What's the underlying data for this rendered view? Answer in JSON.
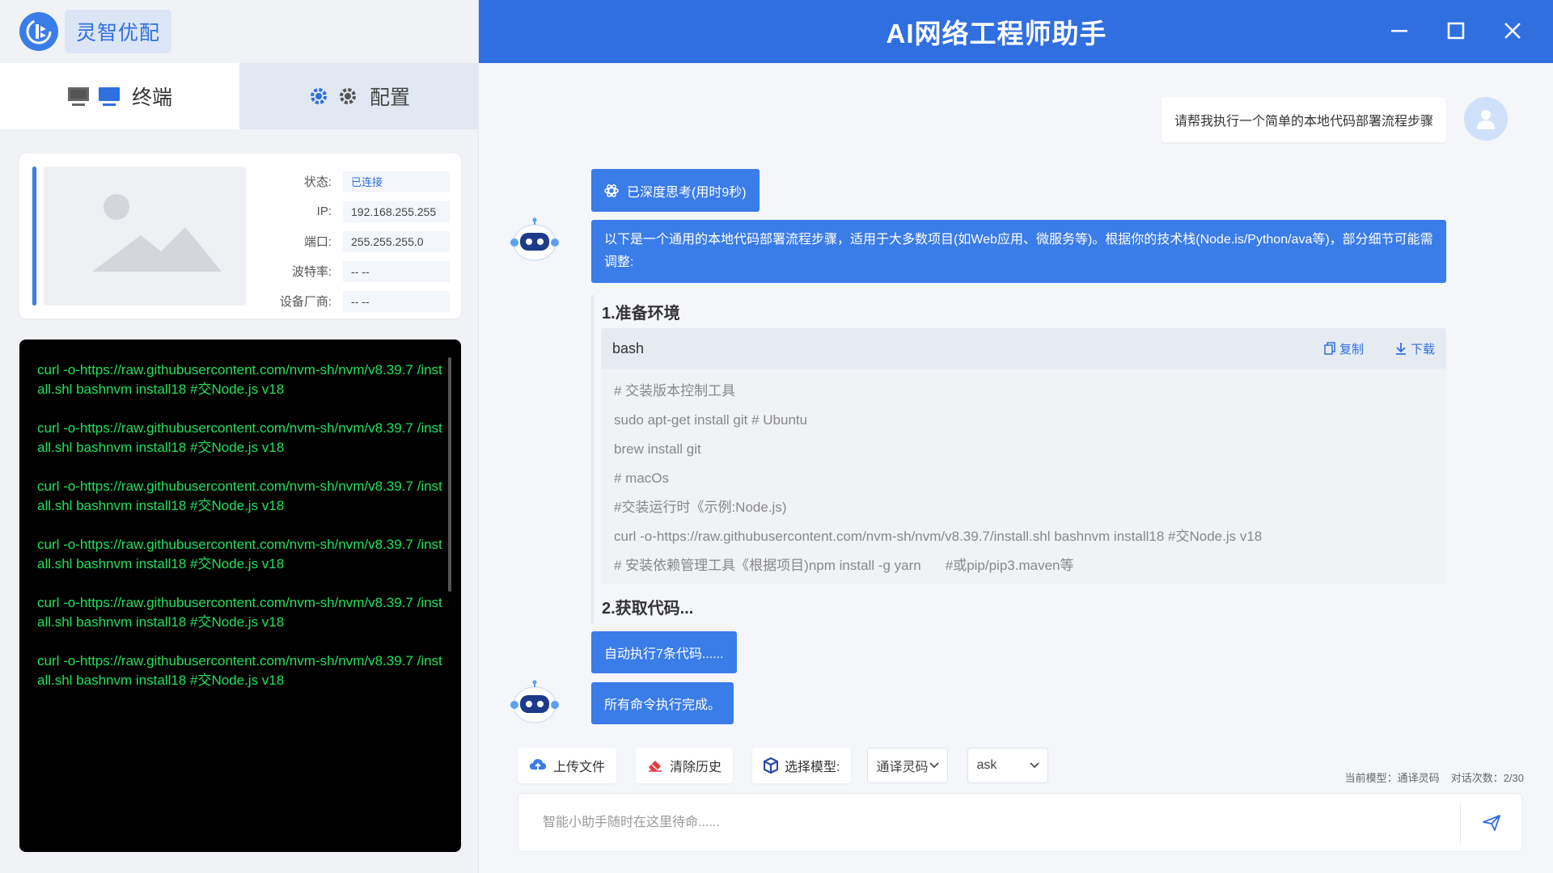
{
  "brand": {
    "name": "灵智优配"
  },
  "tabs": [
    {
      "label": "终端",
      "icon": "monitor-icon",
      "active": true
    },
    {
      "label": "配置",
      "icon": "gear-icon",
      "active": false
    }
  ],
  "device": {
    "fields": [
      {
        "label": "状态:",
        "value": "已连接"
      },
      {
        "label": "IP:",
        "value": "192.168.255.255"
      },
      {
        "label": "端口:",
        "value": "255.255.255.0"
      },
      {
        "label": "波特率:",
        "value": "-- --"
      },
      {
        "label": "设备厂商:",
        "value": "-- --"
      }
    ]
  },
  "terminal": {
    "lines": [
      "curl -o-https://raw.githubusercontent.com/nvm-sh/nvm/v8.39.7 /install.shl bashnvm install18 #交Node.js v18",
      "curl -o-https://raw.githubusercontent.com/nvm-sh/nvm/v8.39.7 /install.shl bashnvm install18 #交Node.js v18",
      "curl -o-https://raw.githubusercontent.com/nvm-sh/nvm/v8.39.7 /install.shl bashnvm install18 #交Node.js v18",
      "curl -o-https://raw.githubusercontent.com/nvm-sh/nvm/v8.39.7 /install.shl bashnvm install18 #交Node.js v18",
      "curl -o-https://raw.githubusercontent.com/nvm-sh/nvm/v8.39.7 /install.shl bashnvm install18 #交Node.js v18",
      "curl -o-https://raw.githubusercontent.com/nvm-sh/nvm/v8.39.7 /install.shl bashnvm install18 #交Node.js v18"
    ]
  },
  "header": {
    "title": "AI网络工程师助手"
  },
  "chat": {
    "user_message": "请帮我执行一个简单的本地代码部署流程步骤",
    "think_label": "已深度思考(用时9秒)",
    "bot_intro": "以下是一个通用的本地代码部署流程步骤，适用于大多数项目(如Web应用、微服务等)。根据你的技术栈(Node.is/Python/ava等)，部分细节可能需调整:",
    "section1_title": "1.准备环境",
    "code": {
      "lang": "bash",
      "copy_label": "复制",
      "download_label": "下载",
      "lines": [
        "# 交装版本控制工具",
        "sudo apt-get install git # Ubuntu",
        "brew install git",
        "# macOs",
        "#交装运行时《示例:Node.js)",
        "curl -o-https://raw.githubusercontent.com/nvm-sh/nvm/v8.39.7/install.shl bashnvm install18 #交Node.js v18"
      ],
      "last_line_a": "# 安装依赖管理工具《根据项目)npm install -g yarn",
      "last_line_b": "#或pip/pip3.maven等"
    },
    "section2_title": "2.获取代码...",
    "exec_label": "自动执行7条代码......",
    "done_label": "所有命令执行完成。"
  },
  "toolbar": {
    "upload_label": "上传文件",
    "clear_label": "清除历史",
    "model_label": "选择模型:",
    "model_value": "通译灵码",
    "mode_value": "ask"
  },
  "meta": {
    "current_model": "当前模型：通译灵码",
    "turns": "对话次数：2/30"
  },
  "input": {
    "placeholder": "智能小助手随时在这里待命......"
  },
  "colors": {
    "primary": "#2f6fe0",
    "bubble": "#3a7ce8",
    "terminal_text": "#22e05a"
  }
}
